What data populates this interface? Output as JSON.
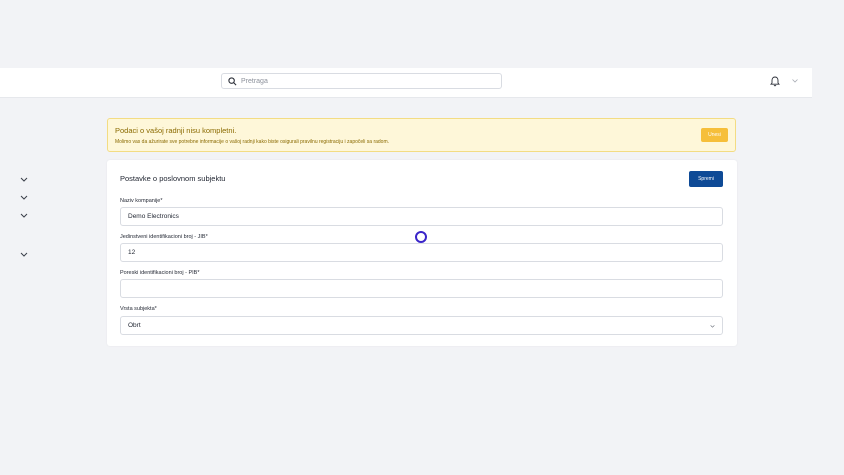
{
  "header": {
    "search": {
      "placeholder": "Pretraga",
      "value": ""
    },
    "icons": {
      "search": "search-icon",
      "notifications": "bell-icon",
      "user_menu": "chevron-down-icon"
    }
  },
  "sidebar": {
    "collapsed_groups": 4,
    "icon": "chevron-down-icon"
  },
  "alert": {
    "title": "Podaci o vašoj radnji nisu kompletni.",
    "text": "Molimo vas da ažurirate sve potrebne informacije o vašoj radnji kako biste osigurali pravilnu registraciju i započeli sa radom.",
    "button_label": "Unesi",
    "colors": {
      "background": "#fef7d9",
      "border": "#f3dc83",
      "text": "#8a6a00",
      "button": "#f6bf3a"
    }
  },
  "form": {
    "title": "Postavke o poslovnom subjektu",
    "save_label": "Spremi",
    "fields": {
      "company_name": {
        "label": "Naziv kompanije*",
        "value": "Demo Electronics"
      },
      "jib": {
        "label": "Jedinstveni identifikacioni broj - JIB*",
        "value": "12"
      },
      "pib": {
        "label": "Poreski identifikacioni broj - PIB*",
        "value": ""
      },
      "entity_type": {
        "label": "Vrsta subjekta*",
        "value": "Obrt"
      }
    },
    "colors": {
      "primary": "#0e4a96"
    }
  }
}
